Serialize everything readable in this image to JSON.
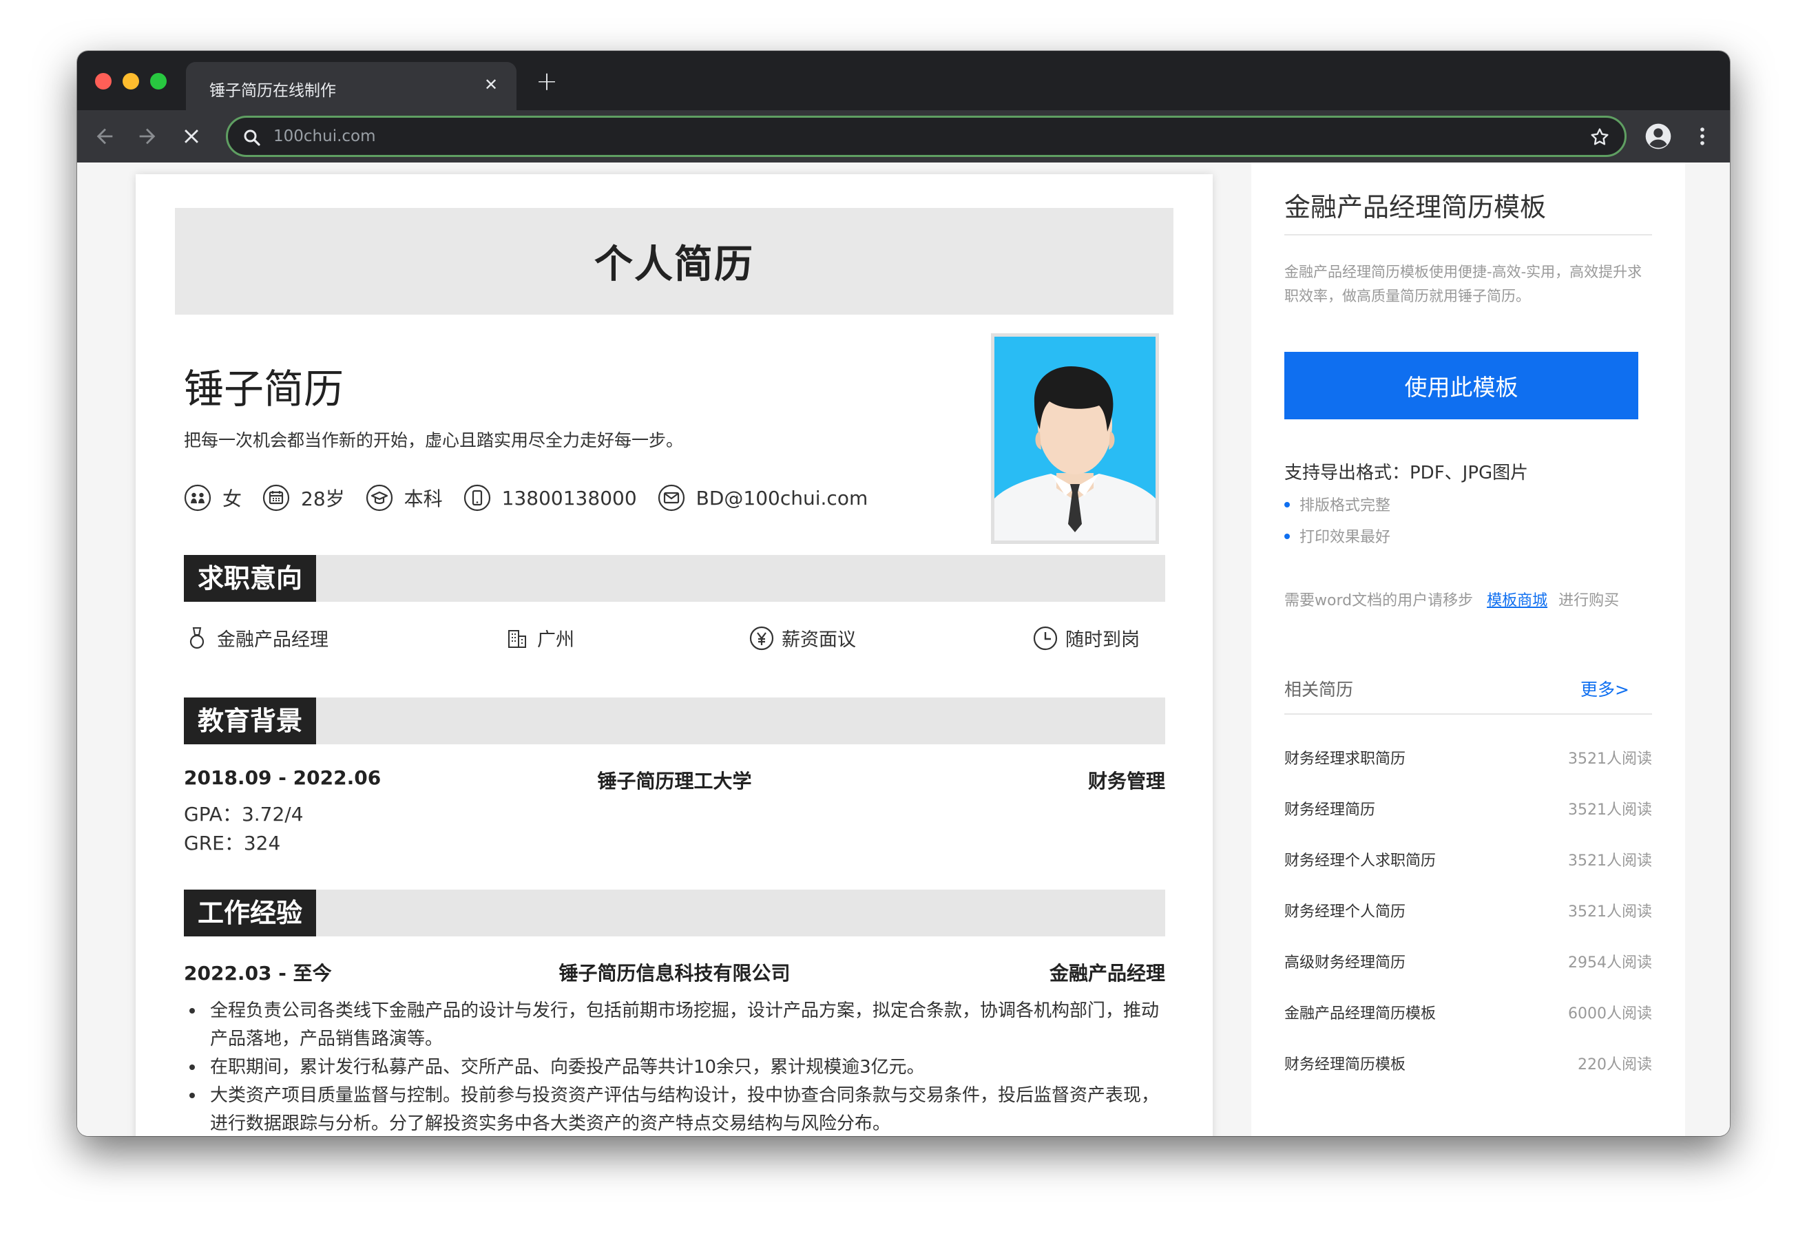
{
  "browser": {
    "tab_title": "锤子简历在线制作",
    "url": "100chui.com"
  },
  "resume": {
    "header": "个人简历",
    "name": "锤子简历",
    "motto": "把每一次机会都当作新的开始，虚心且踏实用尽全力走好每一步。",
    "info": {
      "gender": "女",
      "age": "28岁",
      "degree": "本科",
      "phone": "13800138000",
      "email": "BD@100chui.com"
    },
    "sections": {
      "intent": "求职意向",
      "education": "教育背景",
      "work": "工作经验"
    },
    "intent": {
      "position": "金融产品经理",
      "city": "广州",
      "salary": "薪资面议",
      "availability": "随时到岗"
    },
    "education": {
      "period": "2018.09 - 2022.06",
      "school": "锤子简历理工大学",
      "major": "财务管理",
      "gpa": "GPA：3.72/4",
      "gre": "GRE：324"
    },
    "work": {
      "period": "2022.03 - 至今",
      "company": "锤子简历信息科技有限公司",
      "title": "金融产品经理",
      "bullets": [
        "全程负责公司各类线下金融产品的设计与发行，包括前期市场挖掘，设计产品方案，拟定合条款，协调各机构部门，推动产品落地，产品销售路演等。",
        "在职期间，累计发行私募产品、交所产品、向委投产品等共计10余只，累计规模逾3亿元。",
        "大类资产项目质量监督与控制。投前参与投资资产评估与结构设计，投中协查合同条款与交易条件，投后监督资产表现，进行数据跟踪与分析。分了解投资实务中各大类资产的资产特点交易结构与风险分布。"
      ]
    }
  },
  "sidebar": {
    "title": "金融产品经理简历模板",
    "description": "金融产品经理简历模板使用便捷-高效-实用，高效提升求职效率，做高质量简历就用锤子简历。",
    "use_button": "使用此模板",
    "export_formats": "支持导出格式：PDF、JPG图片",
    "features": [
      "排版格式完整",
      "打印效果最好"
    ],
    "word_prefix": "需要word文档的用户请移步",
    "word_link": "模板商城",
    "word_suffix": "进行购买",
    "related_title": "相关简历",
    "more_link": "更多>",
    "related": [
      {
        "title": "财务经理求职简历",
        "views": "3521人阅读"
      },
      {
        "title": "财务经理简历",
        "views": "3521人阅读"
      },
      {
        "title": "财务经理个人求职简历",
        "views": "3521人阅读"
      },
      {
        "title": "财务经理个人简历",
        "views": "3521人阅读"
      },
      {
        "title": "高级财务经理简历",
        "views": "2954人阅读"
      },
      {
        "title": "金融产品经理简历模板",
        "views": "6000人阅读"
      },
      {
        "title": "财务经理简历模板",
        "views": "220人阅读"
      }
    ]
  },
  "colors": {
    "accent": "#0f6ff0",
    "section_title_bg": "#222222",
    "section_bar_bg": "#e6e6e6",
    "photo_bg": "#29bcf4"
  }
}
